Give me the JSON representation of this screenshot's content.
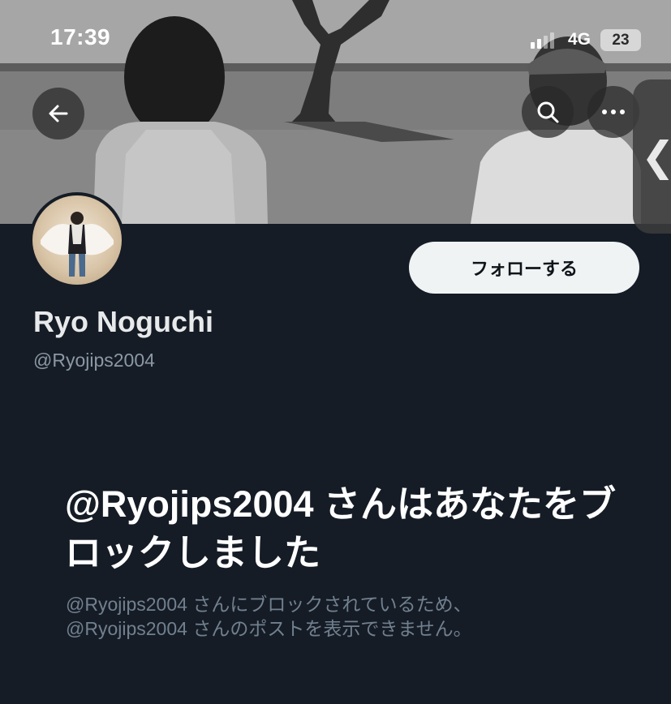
{
  "status_bar": {
    "time": "17:39",
    "network": "4G",
    "battery": "23"
  },
  "header": {
    "back_icon": "arrow-left-icon",
    "search_icon": "search-icon",
    "more_icon": "more-horizontal-icon",
    "side_handle_icon": "chevron-left-icon"
  },
  "profile": {
    "display_name": "Ryo Noguchi",
    "handle": "@Ryojips2004",
    "follow_label": "フォローする"
  },
  "blocked": {
    "title": "@Ryojips2004 さんはあなたをブロックしました",
    "line1": "@Ryojips2004 さんにブロックされているため、",
    "line2": "@Ryojips2004 さんのポストを表示できません。"
  },
  "colors": {
    "background": "#151c26",
    "follow_button_bg": "#eff3f4",
    "muted_text": "#8b98a5"
  }
}
